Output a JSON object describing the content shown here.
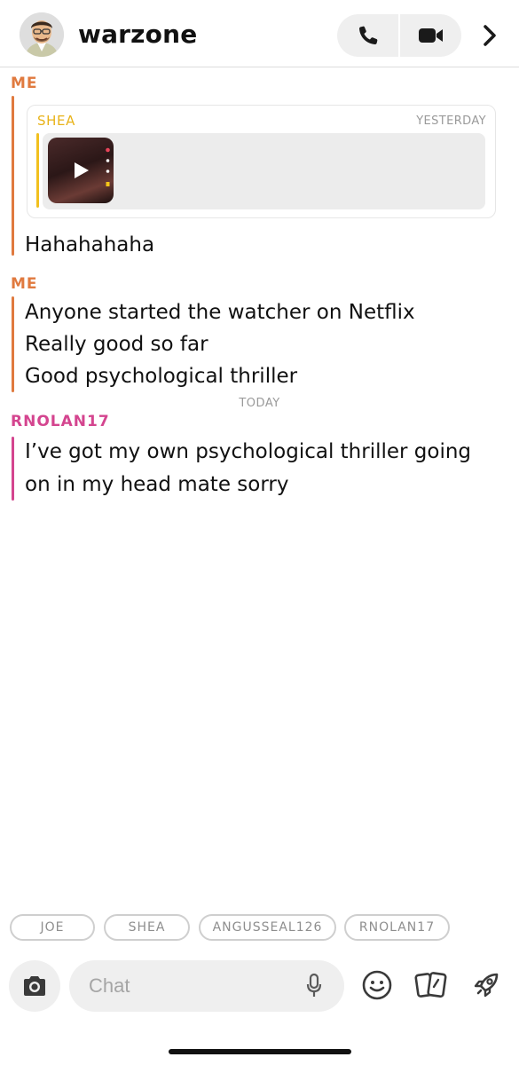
{
  "header": {
    "title": "warzone",
    "avatar_icon": "bitmoji-avatar",
    "call_icon": "phone-icon",
    "video_icon": "video-camera-icon",
    "more_icon": "chevron-right-icon"
  },
  "messages": [
    {
      "sender": "ME",
      "sender_color": "#e07a3f",
      "quoted": {
        "sender": "SHEA",
        "time": "YESTERDAY",
        "sender_color": "#e8b31a",
        "media": "video-thumbnail"
      },
      "lines": [
        "Hahahahaha"
      ]
    },
    {
      "sender": "ME",
      "sender_color": "#e07a3f",
      "lines": [
        "Anyone started the watcher on Netflix",
        "Really good so far",
        "Good psychological thriller"
      ]
    },
    {
      "day_label": "TODAY"
    },
    {
      "sender": "RNOLAN17",
      "sender_color": "#d4458f",
      "lines": [
        "I’ve got my own psychological thriller going",
        "on in my head mate sorry"
      ]
    }
  ],
  "participants": [
    "JOE",
    "SHEA",
    "ANGUSSEAL126",
    "RNOLAN17"
  ],
  "composer": {
    "placeholder": "Chat",
    "camera_icon": "camera-icon",
    "mic_icon": "microphone-icon",
    "sticker_icon": "smiley-icon",
    "cards_icon": "cards-icon",
    "games_icon": "rocket-icon"
  }
}
